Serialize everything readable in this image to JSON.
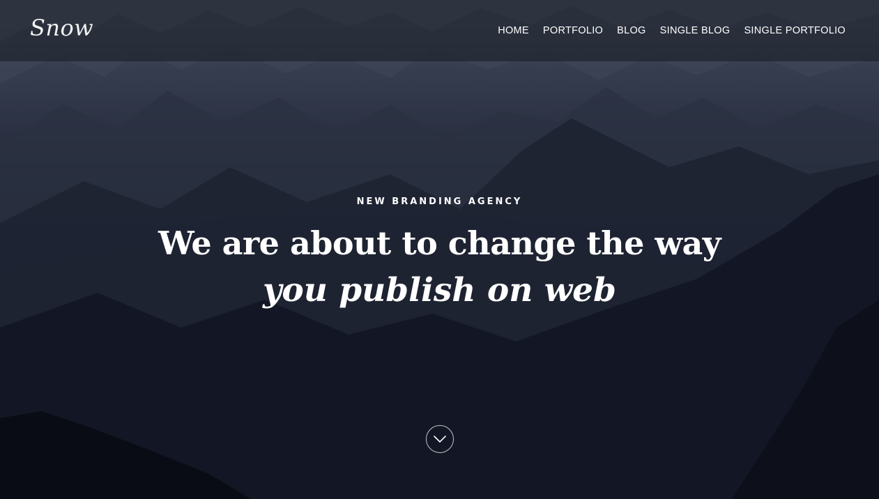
{
  "brand": {
    "logo_text": "Snow"
  },
  "nav": {
    "items": [
      {
        "label": "HOME"
      },
      {
        "label": "PORTFOLIO"
      },
      {
        "label": "BLOG"
      },
      {
        "label": "SINGLE BLOG"
      },
      {
        "label": "SINGLE PORTFOLIO"
      }
    ]
  },
  "hero": {
    "eyebrow": "NEW BRANDING AGENCY",
    "headline": "We are about to change the way",
    "headline_italic": "you publish on web",
    "scroll_icon": "chevron-down-icon"
  },
  "colors": {
    "text": "#ffffff",
    "header_bg": "#161922",
    "background": "#10131e"
  }
}
